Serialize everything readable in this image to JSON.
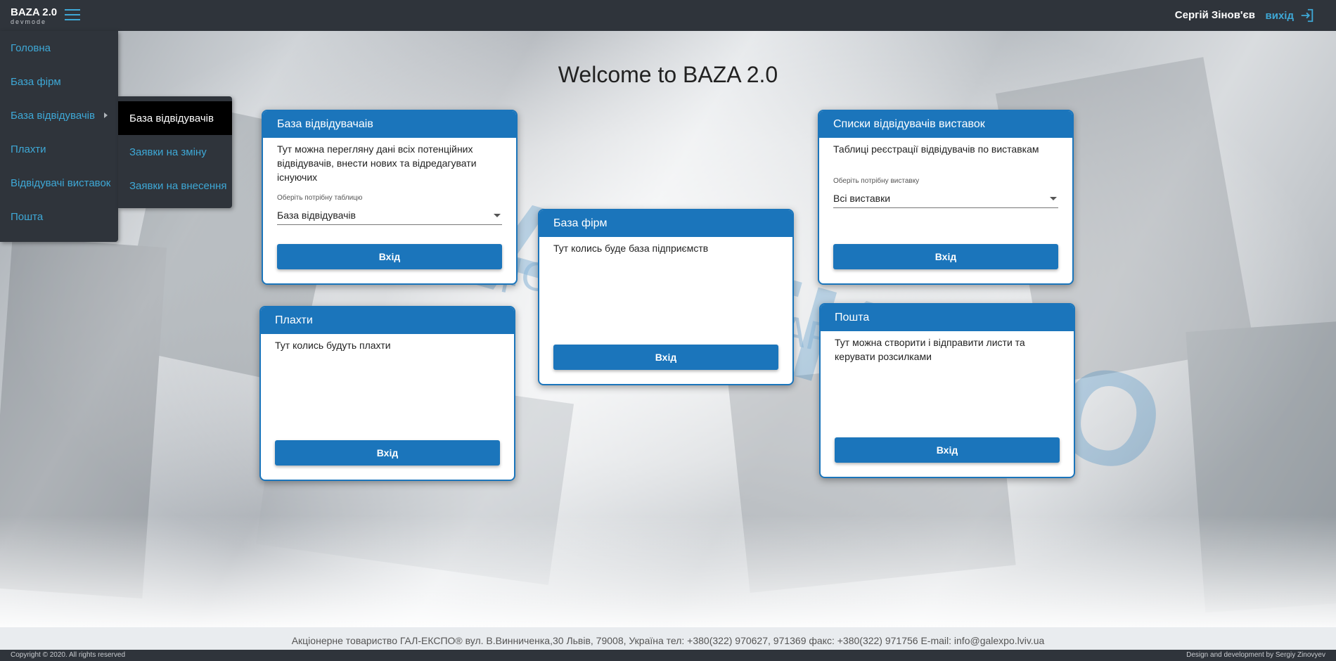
{
  "topbar": {
    "brand_title": "BAZA 2.0",
    "brand_sub": "devmode",
    "username": "Сергій Зінов'єв",
    "logout_label": "вихід"
  },
  "sidebar": {
    "items": [
      {
        "label": "Головна"
      },
      {
        "label": "База фірм"
      },
      {
        "label": "База відвідувачів"
      },
      {
        "label": "Плахти"
      },
      {
        "label": "Відвідувачі виставок"
      },
      {
        "label": "Пошта"
      }
    ],
    "submenu": [
      {
        "label": "База відвідувачів"
      },
      {
        "label": "Заявки на зміну"
      },
      {
        "label": "Заявки на внесення"
      }
    ]
  },
  "main": {
    "title": "Welcome to BAZA 2.0",
    "cards": {
      "visitors": {
        "title": "База відвідувачаів",
        "text": "Тут можна переглянy дані всіх потенційних відвідувачів, внести нових та відредагувати існуючих",
        "select_label": "Оберіть потрібну таблицю",
        "select_value": "База відвідувачів",
        "button": "Вхід"
      },
      "firms": {
        "title": "База фірм",
        "text": "Тут колись буде база підприємств",
        "button": "Вхід"
      },
      "lists": {
        "title": "Списки відвідувачів виставок",
        "text": "Таблиці реєстрації відвідувачів по виставкам",
        "select_label": "Оберіть потрібну виставку",
        "select_value": "Всі виставки",
        "button": "Вхід"
      },
      "plakhty": {
        "title": "Плахти",
        "text": "Тут колись будуть плахти",
        "button": "Вхід"
      },
      "mail": {
        "title": "Пошта",
        "text": "Тут можна створити і відправити листи та керувати розсилками",
        "button": "Вхід"
      }
    }
  },
  "footer": {
    "info": "Акціонерне товариство ГАЛ-ЕКСПО® вул. В.Винниченка,30 Львів, 79008, Україна тел: +380(322) 970627, 971369 факс: +380(322) 971756 E-mail: info@galexpo.lviv.ua",
    "copyright": "Copyright © 2020. All rights reserved",
    "design": "Design and development by Sergiy Zinovyev"
  },
  "colors": {
    "topbar": "#2f343b",
    "accent": "#3ea8d6",
    "card_primary": "#1b75bb",
    "submenu_active": "#000000"
  }
}
